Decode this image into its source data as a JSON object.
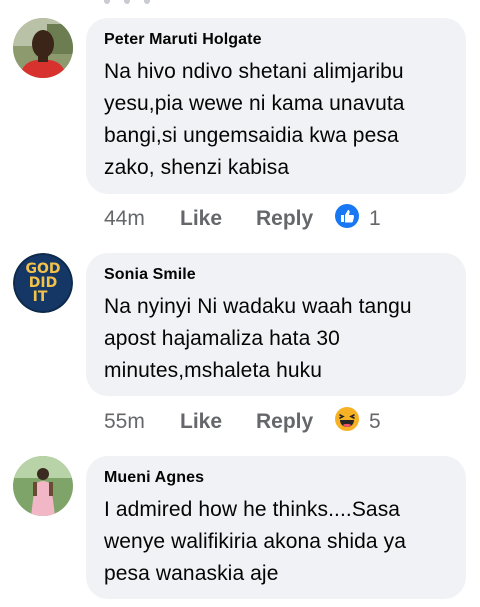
{
  "comments": [
    {
      "author": "Peter Maruti Holgate",
      "text": "Na hivo ndivo shetani alimjaribu yesu,pia wewe ni kama unavuta bangi,si ungemsaidia kwa pesa zako, shenzi kabisa",
      "time": "44m",
      "like_label": "Like",
      "reply_label": "Reply",
      "reaction": "like-icon",
      "reaction_count": "1"
    },
    {
      "author": "Sonia Smile",
      "avatar_text": "GOD DID IT",
      "text": "Na nyinyi Ni wadaku waah tangu apost hajamaliza hata 30 minutes,mshaleta huku",
      "time": "55m",
      "like_label": "Like",
      "reply_label": "Reply",
      "reaction": "haha-icon",
      "reaction_count": "5"
    },
    {
      "author": "Mueni Agnes",
      "text": "I admired how he thinks....Sasa wenye walifikiria akona shida ya pesa wanaskia aje"
    }
  ],
  "colors": {
    "bubble": "#f0f2f5",
    "secondary_text": "#65676b",
    "like_blue": "#1877f2",
    "haha_yellow": "#f7b125"
  }
}
